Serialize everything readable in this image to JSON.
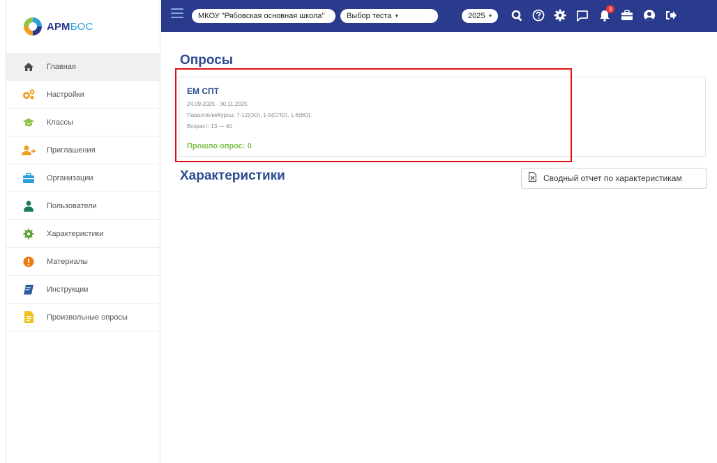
{
  "brand": {
    "name_main": "АРМ",
    "name_accent": "БОС"
  },
  "sidebar": {
    "items": [
      {
        "label": "Главная",
        "icon": "home-icon",
        "color": "#4a4a4a"
      },
      {
        "label": "Настройки",
        "icon": "gears-icon",
        "color": "#f0a020"
      },
      {
        "label": "Классы",
        "icon": "graduation-cap-icon",
        "color": "#8bc34a"
      },
      {
        "label": "Приглашения",
        "icon": "add-user-icon",
        "color": "#f0a020"
      },
      {
        "label": "Организации",
        "icon": "briefcase-icon",
        "color": "#2a9fd8"
      },
      {
        "label": "Пользователи",
        "icon": "user-icon",
        "color": "#1a7a5a"
      },
      {
        "label": "Характеристики",
        "icon": "gear-icon",
        "color": "#5aa030"
      },
      {
        "label": "Материалы",
        "icon": "exclamation-icon",
        "color": "#f07a10"
      },
      {
        "label": "Инструкции",
        "icon": "book-icon",
        "color": "#2a5a9f"
      },
      {
        "label": "Произвольные опросы",
        "icon": "document-icon",
        "color": "#f0c020"
      }
    ]
  },
  "topbar": {
    "organization": "МКОУ \"Рябовская основная школа\"",
    "test_select": "Выбор теста",
    "year": "2025",
    "notification_count": "3",
    "icons": [
      "search-icon",
      "help-icon",
      "settings-icon",
      "chat-icon",
      "bell-icon",
      "briefcase-icon",
      "profile-icon",
      "logout-icon"
    ]
  },
  "main": {
    "surveys_title": "Опросы",
    "survey": {
      "title": "ЕМ СПТ",
      "dates": "24.09.2025 - 30.11.2025",
      "parallels": "Параллели/Курсы: 7-12(ОО), 1-5(СПО), 1-6(ВО).",
      "age": "Возраст: 13 — 40",
      "result": "Прошло опрос: 0"
    },
    "characteristics_title": "Характеристики",
    "report_button": "Сводный отчет по характеристикам"
  }
}
